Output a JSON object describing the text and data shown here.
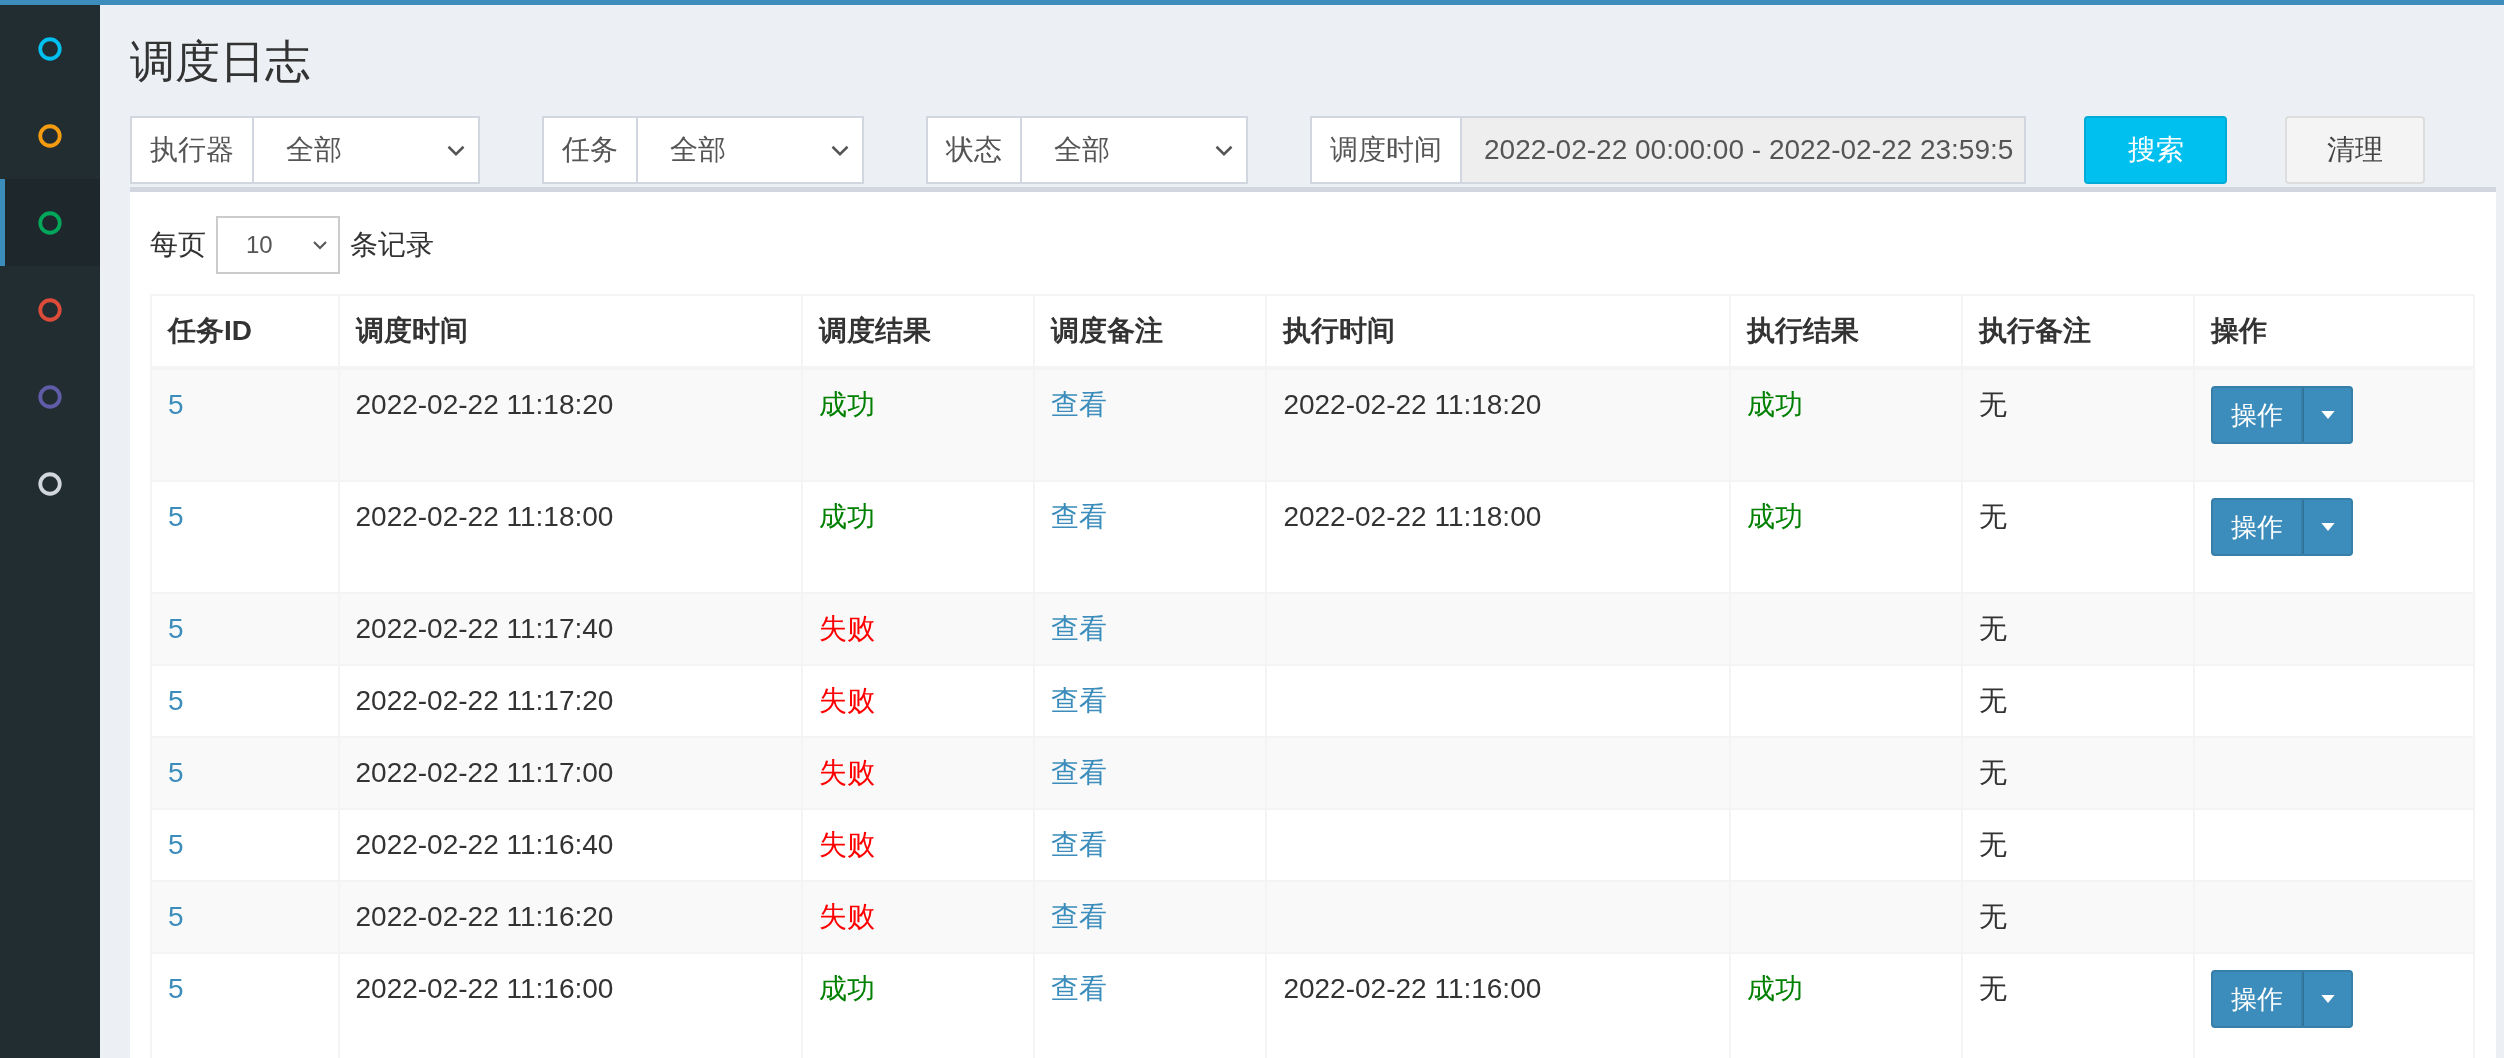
{
  "sidebar": {
    "items": [
      {
        "color": "#00c0ef",
        "selected": false
      },
      {
        "color": "#f39c12",
        "selected": false
      },
      {
        "color": "#00a65a",
        "selected": true
      },
      {
        "color": "#dd4b39",
        "selected": false
      },
      {
        "color": "#605ca8",
        "selected": false
      },
      {
        "color": "#d2d6de",
        "selected": false
      }
    ]
  },
  "title": "调度日志",
  "filters": [
    {
      "kind": "select",
      "label": "执行器",
      "value": "全部"
    },
    {
      "kind": "select",
      "label": "任务",
      "value": "全部"
    },
    {
      "kind": "select",
      "label": "状态",
      "value": "全部"
    },
    {
      "kind": "range",
      "label": "调度时间",
      "value": "2022-02-22 00:00:00 - 2022-02-22 23:59:5"
    }
  ],
  "buttons": [
    {
      "kind": "primary",
      "label": "搜索"
    },
    {
      "kind": "default",
      "label": "清理"
    }
  ],
  "page_size": {
    "before": "每页",
    "value": "10",
    "after": "条记录"
  },
  "table": {
    "columns": [
      "任务ID",
      "调度时间",
      "调度结果",
      "调度备注",
      "执行时间",
      "执行结果",
      "执行备注",
      "操作"
    ],
    "rows": [
      {
        "id": "5",
        "trigger_time": "2022-02-22 11:18:20",
        "trigger_result": {
          "text": "成功",
          "kind": "success"
        },
        "trigger_msg": "查看",
        "handle_time": "2022-02-22 11:18:20",
        "handle_result": {
          "text": "成功",
          "kind": "success"
        },
        "handle_msg": "无",
        "action": "操作"
      },
      {
        "id": "5",
        "trigger_time": "2022-02-22 11:18:00",
        "trigger_result": {
          "text": "成功",
          "kind": "success"
        },
        "trigger_msg": "查看",
        "handle_time": "2022-02-22 11:18:00",
        "handle_result": {
          "text": "成功",
          "kind": "success"
        },
        "handle_msg": "无",
        "action": "操作"
      },
      {
        "id": "5",
        "trigger_time": "2022-02-22 11:17:40",
        "trigger_result": {
          "text": "失败",
          "kind": "fail"
        },
        "trigger_msg": "查看",
        "handle_msg": "无"
      },
      {
        "id": "5",
        "trigger_time": "2022-02-22 11:17:20",
        "trigger_result": {
          "text": "失败",
          "kind": "fail"
        },
        "trigger_msg": "查看",
        "handle_msg": "无"
      },
      {
        "id": "5",
        "trigger_time": "2022-02-22 11:17:00",
        "trigger_result": {
          "text": "失败",
          "kind": "fail"
        },
        "trigger_msg": "查看",
        "handle_msg": "无"
      },
      {
        "id": "5",
        "trigger_time": "2022-02-22 11:16:40",
        "trigger_result": {
          "text": "失败",
          "kind": "fail"
        },
        "trigger_msg": "查看",
        "handle_msg": "无"
      },
      {
        "id": "5",
        "trigger_time": "2022-02-22 11:16:20",
        "trigger_result": {
          "text": "失败",
          "kind": "fail"
        },
        "trigger_msg": "查看",
        "handle_msg": "无"
      },
      {
        "id": "5",
        "trigger_time": "2022-02-22 11:16:00",
        "trigger_result": {
          "text": "成功",
          "kind": "success"
        },
        "trigger_msg": "查看",
        "handle_time": "2022-02-22 11:16:00",
        "handle_result": {
          "text": "成功",
          "kind": "success"
        },
        "handle_msg": "无",
        "action": "操作"
      }
    ]
  }
}
